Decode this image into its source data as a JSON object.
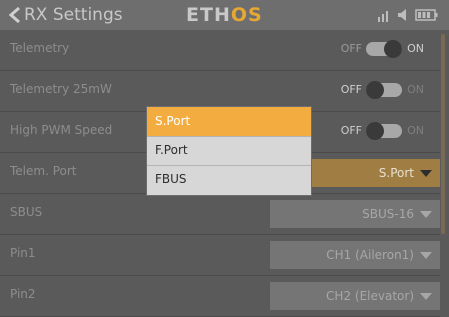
{
  "header": {
    "title": "RX Settings",
    "logo_left": "ETH",
    "logo_right": "OS"
  },
  "rows": [
    {
      "label": "Telemetry",
      "type": "toggle",
      "off_label": "OFF",
      "on_label": "ON",
      "state": "on"
    },
    {
      "label": "Telemetry 25mW",
      "type": "toggle",
      "off_label": "OFF",
      "on_label": "ON",
      "state": "off"
    },
    {
      "label": "High PWM Speed",
      "type": "toggle",
      "off_label": "OFF",
      "on_label": "ON",
      "state": "off"
    },
    {
      "label": "Telem. Port",
      "type": "select",
      "value": "S.Port"
    },
    {
      "label": "SBUS",
      "type": "select",
      "value": "SBUS-16"
    },
    {
      "label": "Pin1",
      "type": "select",
      "value": "CH1 (Aileron1)"
    },
    {
      "label": "Pin2",
      "type": "select",
      "value": "CH2 (Elevator)"
    }
  ],
  "dropdown": {
    "options": [
      "S.Port",
      "F.Port",
      "FBUS"
    ],
    "selected": "S.Port"
  },
  "colors": {
    "accent": "#f3ac40",
    "active_select": "#a07d43",
    "background": "#5a5a5a"
  },
  "icons": [
    "back-chevron-icon",
    "signal-icon",
    "volume-icon",
    "battery-icon"
  ]
}
